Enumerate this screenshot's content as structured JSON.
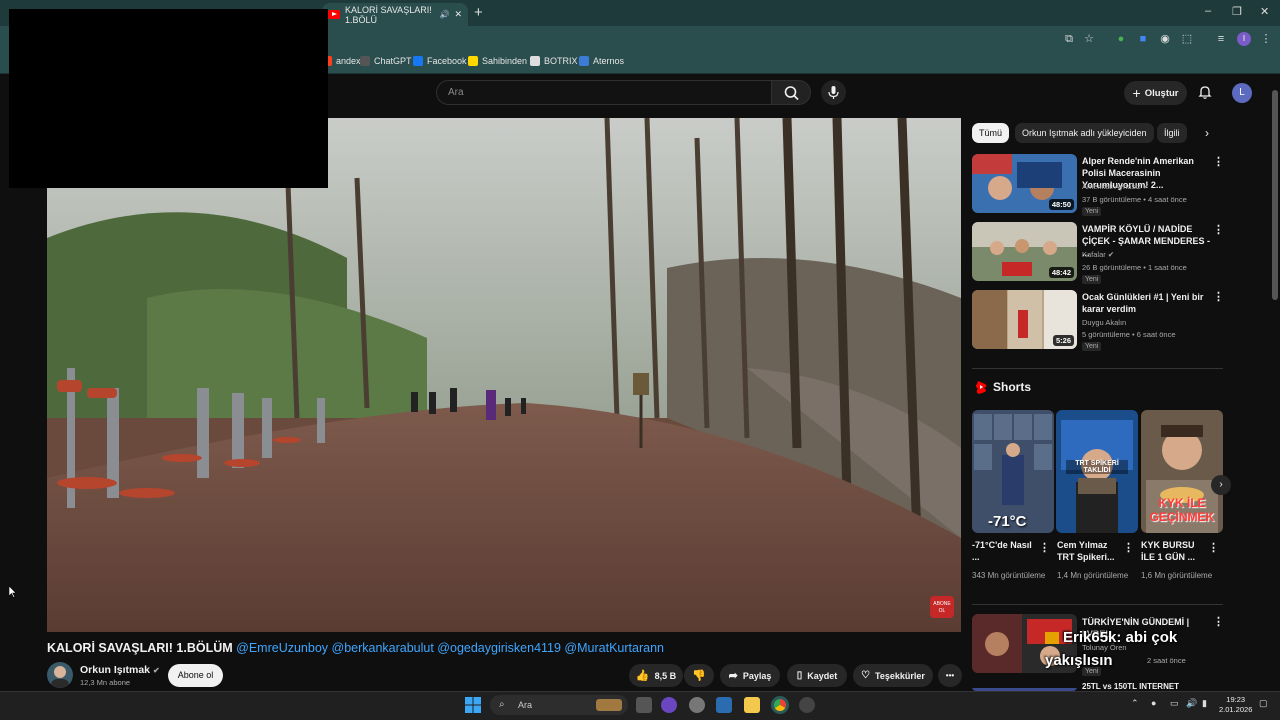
{
  "browser": {
    "active_tab_title": "KALORİ SAVAŞLARI! 1.BÖLÜ",
    "new_tab_symbol": "+",
    "window_controls": [
      "–",
      "❐",
      "✕"
    ],
    "profile_initial": "I"
  },
  "bookmarks": [
    {
      "label": "andex",
      "icon": "yandex-icon",
      "color": "#fc3f1d"
    },
    {
      "label": "ChatGPT",
      "icon": "chatgpt-icon",
      "color": "#555555"
    },
    {
      "label": "Facebook",
      "icon": "facebook-icon",
      "color": "#1877f2"
    },
    {
      "label": "Sahibinden",
      "icon": "sahibinden-icon",
      "color": "#ffd800"
    },
    {
      "label": "BOTRIX",
      "icon": "botrix-icon",
      "color": "#dddddd"
    },
    {
      "label": "Aternos",
      "icon": "aternos-icon",
      "color": "#3d7bd9"
    }
  ],
  "header": {
    "search_placeholder": "Ara",
    "create_label": "Oluştur",
    "avatar_initial": "L"
  },
  "video": {
    "title": "KALORİ SAVAŞLARI! 1.BÖLÜM",
    "mentions": "@EmreUzunboy @berkankarabulut @ogedaygirisken4119 @MuratKurtarann",
    "subscribe_overlay": "ABONE OL",
    "channel": "Orkun Işıtmak",
    "subscribers": "12,3 Mn abone",
    "subscribe_label": "Abone ol",
    "likes": "8,5 B",
    "share_label": "Paylaş",
    "save_label": "Kaydet",
    "thanks_label": "Teşekkürler",
    "more_label": "•••"
  },
  "sidebar": {
    "chips": [
      "Tümü",
      "Orkun Işıtmak adlı yükleyiciden",
      "İlgili"
    ],
    "recommendations": [
      {
        "title": "Alper Rende'nin Amerikan Polisi Macerasinin Yorumluyorum! 2...",
        "channel": "Amerikali Aynasiz",
        "meta": "37 B görüntüleme • 4 saat önce",
        "badge": "Yeni",
        "duration": "48:50",
        "thumb_color": "#3a6fb0"
      },
      {
        "title": "VAMPİR KÖYLÜ /  NADİDE ÇİÇEK - ŞAMAR MENDERES - ...",
        "channel": "Kafalar",
        "meta": "26 B görüntüleme • 1 saat önce",
        "badge": "Yeni",
        "duration": "48:42",
        "thumb_color": "#7a8a6a"
      },
      {
        "title": "Ocak Günlükleri #1 | Yeni bir karar verdim",
        "channel": "Duygu Akalın",
        "meta": "5 görüntüleme • 6 saat önce",
        "badge": "Yeni",
        "duration": "5:26",
        "thumb_color": "#b9a58a"
      }
    ],
    "shorts_heading": "Shorts",
    "shorts": [
      {
        "title": "-71°C'de Nasıl ...",
        "views": "343 Mn görüntüleme",
        "thumb_text": "-71°C",
        "thumb_color": "#3f4f6a"
      },
      {
        "title": "Cem Yılmaz TRT Spikeri...",
        "views": "1,4 Mn görüntüleme",
        "thumb_text": "TRT SPİKERİ TAKLİDİ",
        "thumb_color": "#1b4d8a"
      },
      {
        "title": "KYK BURSU İLE 1 GÜN ...",
        "views": "1,6 Mn görüntüleme",
        "thumb_text": "KYK İLE GEÇİNMEK",
        "thumb_color": "#6a5a4a"
      }
    ],
    "next_rec": {
      "title": "TÜRKİYE'NİN GÜNDEMİ | LVBEL",
      "channel": "Tolunay Ören",
      "meta": "2 saat önce",
      "badge": "Yeni"
    },
    "partial_rec_title": "25TL vs 150TL İNTERNET"
  },
  "overlay": {
    "line1": "Erik65k: abi çok",
    "line2": "yakışlısın"
  },
  "taskbar": {
    "search_label": "Ara",
    "time": "19:23",
    "date": "2.01.2026"
  }
}
